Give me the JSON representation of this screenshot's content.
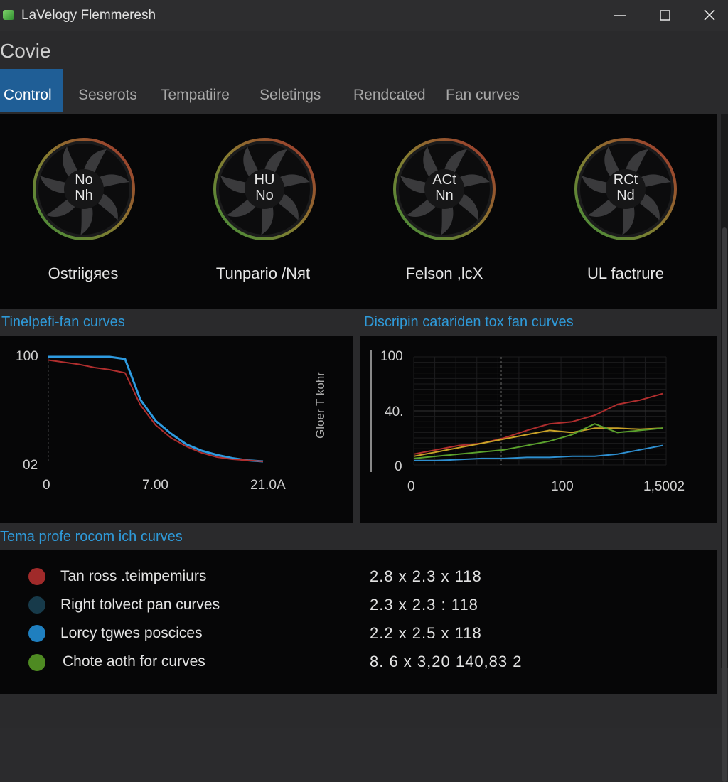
{
  "window": {
    "title": "LaVelogy Flemmeresh"
  },
  "page": {
    "title": "Covie"
  },
  "tabs": [
    {
      "label": "Control"
    },
    {
      "label": "Seserots"
    },
    {
      "label": "Tempatiire"
    },
    {
      "label": "Seletings"
    },
    {
      "label": "Rendcated"
    },
    {
      "label": "Fan curves"
    }
  ],
  "fans": [
    {
      "line1": "No",
      "line2": "Nh",
      "label": "Ostriigяes"
    },
    {
      "line1": "HU",
      "line2": "No",
      "label": "Tunpario /Nяt"
    },
    {
      "line1": "ACt",
      "line2": "Nn",
      "label": "Felson ,lcX"
    },
    {
      "line1": "RCt",
      "line2": "Nd",
      "label": "UL factrure"
    }
  ],
  "left_chart": {
    "header": "Tinelpefi-fan curves",
    "y_ticks": [
      "100",
      "02"
    ],
    "x_ticks": [
      "0",
      "7.00",
      "21.0A"
    ],
    "side_label": "Gloer T kohr"
  },
  "right_chart": {
    "header": "Discripin catariden tox fan curves",
    "y_ticks": [
      "100",
      "40.",
      "0"
    ],
    "x_ticks": [
      "0",
      "100",
      "1,5002"
    ]
  },
  "chart_data": [
    {
      "type": "line",
      "x": [
        0,
        1,
        2,
        3,
        4,
        5,
        6,
        7,
        8,
        9,
        10,
        11,
        12,
        13,
        14
      ],
      "series": [
        {
          "color": "#2e9be0",
          "values": [
            100,
            100,
            100,
            100,
            100,
            98,
            60,
            40,
            28,
            18,
            12,
            8,
            5,
            3,
            2
          ]
        },
        {
          "color": "#b02e2e",
          "values": [
            97,
            95,
            93,
            90,
            88,
            85,
            55,
            36,
            24,
            16,
            10,
            6,
            4,
            3,
            2
          ]
        }
      ],
      "ylim": [
        0,
        100
      ]
    },
    {
      "type": "line",
      "x": [
        0,
        1,
        2,
        3,
        4,
        5,
        6,
        7,
        8,
        9,
        10,
        11
      ],
      "series": [
        {
          "color": "#b02e2e",
          "values": [
            10,
            14,
            18,
            20,
            25,
            32,
            38,
            40,
            46,
            56,
            60,
            66
          ]
        },
        {
          "color": "#c9a227",
          "values": [
            8,
            12,
            16,
            20,
            24,
            28,
            32,
            30,
            34,
            34,
            33,
            34
          ]
        },
        {
          "color": "#5aa02c",
          "values": [
            6,
            8,
            10,
            12,
            14,
            18,
            22,
            28,
            38,
            30,
            32,
            34
          ]
        },
        {
          "color": "#2e8fd0",
          "values": [
            4,
            4,
            5,
            6,
            6,
            7,
            7,
            8,
            8,
            10,
            14,
            18
          ]
        }
      ],
      "ylim": [
        0,
        100
      ]
    }
  ],
  "info": {
    "header": "Tema profe rocom ich curves",
    "rows": [
      {
        "color": "#a02a2a",
        "label": "Tan ross .teimpemiurs",
        "value": "2.8 x 2.3 x 118"
      },
      {
        "color": "#173a4a",
        "label": "Right tolvect pan curves",
        "value": "2.3 x 2.3 : 118"
      },
      {
        "color": "#1f7fbf",
        "label": "Lorcy tgwes poscices",
        "value": "2.2 x 2.5 x 118"
      },
      {
        "color": "#4e8a22",
        "label": "Chote aoth for curves",
        "value": "8. 6 x 3,20 140,83  2"
      }
    ]
  }
}
